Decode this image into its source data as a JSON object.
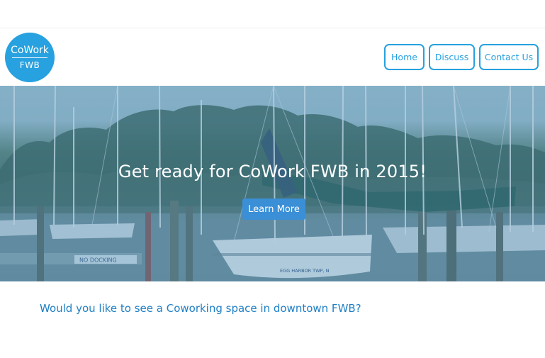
{
  "logo": {
    "line1": "CoWork",
    "line2": "FWB"
  },
  "nav": {
    "items": [
      {
        "label": "Home"
      },
      {
        "label": "Discuss"
      },
      {
        "label": "Contact Us"
      }
    ]
  },
  "hero": {
    "title": "Get ready for CoWork FWB in 2015!",
    "button_label": "Learn More",
    "boat_name": "EGG HARBOR TWP, N",
    "dock_sign": "NO DOCKING"
  },
  "section": {
    "question": "Would you like to see a Coworking space in downtown FWB?"
  },
  "colors": {
    "accent": "#27a1df",
    "button": "#3a8fd6",
    "question_text": "#1f7fc5"
  }
}
